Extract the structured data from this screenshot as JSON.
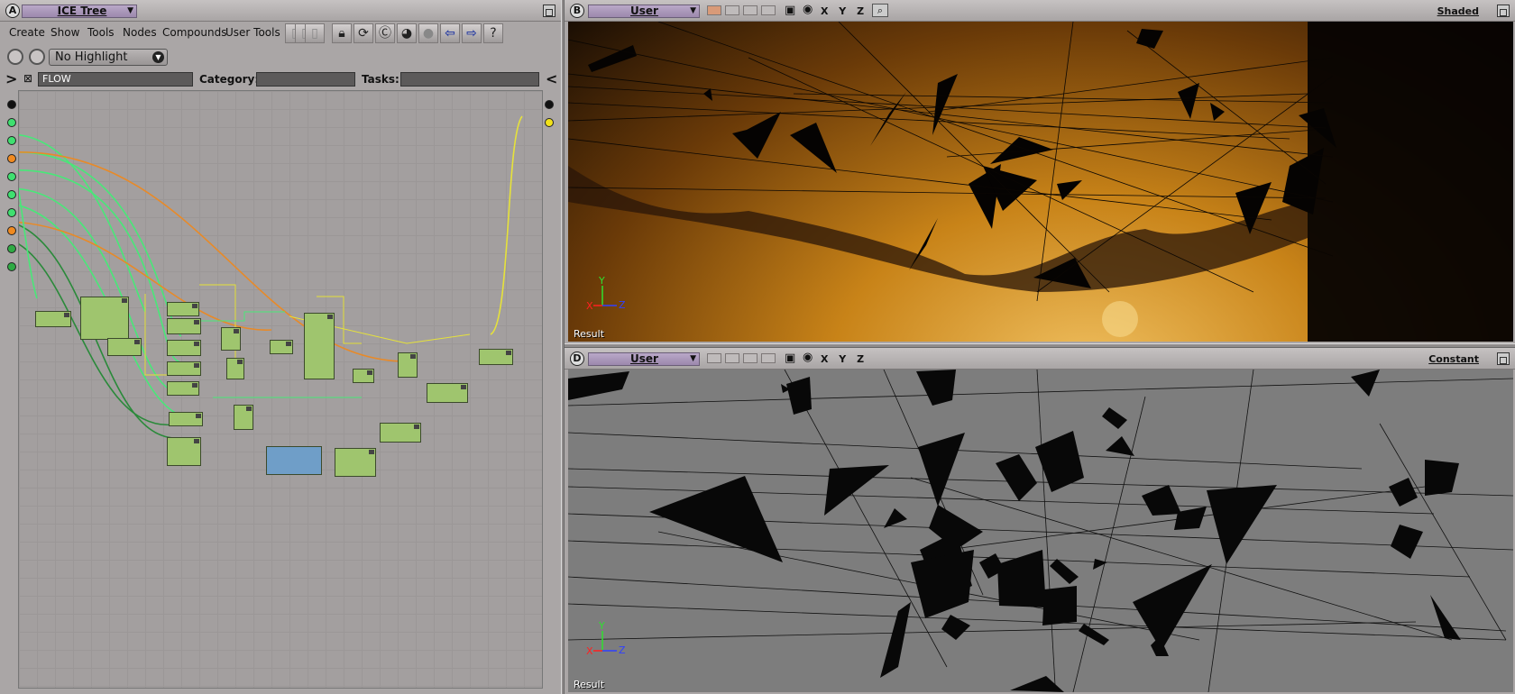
{
  "ice_tree": {
    "badge": "A",
    "title": "ICE Tree",
    "menu": [
      "Create",
      "Show",
      "Tools",
      "Nodes",
      "Compounds",
      "User Tools"
    ],
    "highlight_value": "No Highlight",
    "name_field": "FLOW",
    "category_label": "Category:",
    "category_value": "",
    "tasks_label": "Tasks:",
    "tasks_value": "",
    "port_colors": [
      "#111111",
      "#3fe070",
      "#3fe070",
      "#f08a20",
      "#3fe070",
      "#3fe070",
      "#3fe070",
      "#f08a20",
      "#2faa44",
      "#2faa44"
    ],
    "output_port_colors": [
      "#111111",
      "#f2e21a"
    ],
    "wire_colors": {
      "green": "#48e878",
      "orange": "#e88a28",
      "darkgreen": "#2a8a3a",
      "yellow": "#e6e23a"
    }
  },
  "viewport_b": {
    "badge": "B",
    "camera": "User",
    "axes": "X Y Z",
    "mode": "Shaded",
    "result": "Result",
    "gizmo": {
      "x": "X",
      "y": "Y",
      "z": "Z"
    }
  },
  "viewport_d": {
    "badge": "D",
    "camera": "User",
    "axes": "X Y Z",
    "mode": "Constant",
    "result": "Result",
    "gizmo": {
      "x": "X",
      "y": "Y",
      "z": "Z"
    }
  }
}
